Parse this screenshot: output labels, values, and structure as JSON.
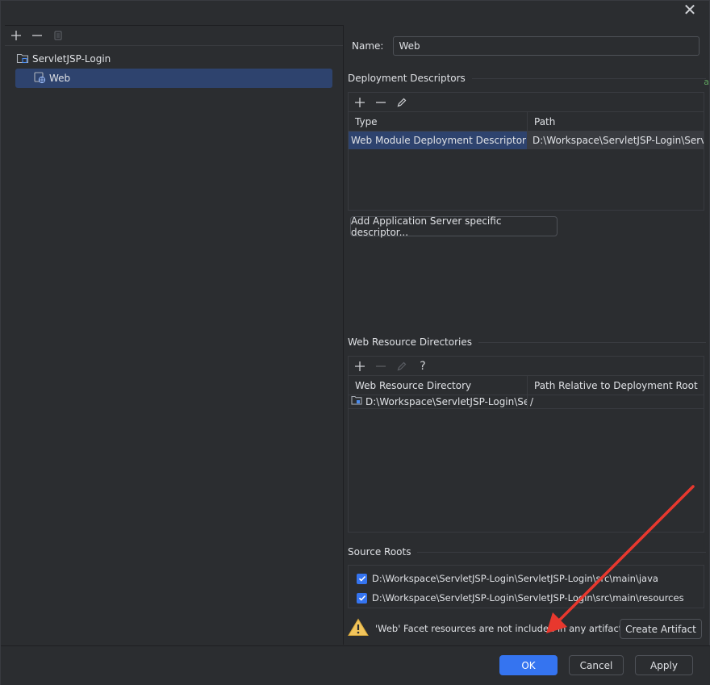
{
  "dialog": {
    "close_label": "✕"
  },
  "left": {
    "toolbar": {
      "add": "+",
      "remove": "−",
      "copy": "⧉"
    },
    "tree": [
      {
        "label": "ServletJSP-Login",
        "icon": "module-folder-icon"
      },
      {
        "label": "Web",
        "icon": "web-facet-icon"
      }
    ]
  },
  "right": {
    "name_label": "Name:",
    "name_value": "Web",
    "deployment": {
      "title": "Deployment Descriptors",
      "columns": [
        "Type",
        "Path"
      ],
      "rows": [
        {
          "type": "Web Module Deployment Descriptor",
          "path": "D:\\Workspace\\ServletJSP-Login\\ServletJ"
        }
      ],
      "add_server_button": "Add Application Server specific descriptor..."
    },
    "resources": {
      "title": "Web Resource Directories",
      "help": "?",
      "columns": [
        "Web Resource Directory",
        "Path Relative to Deployment Root"
      ],
      "rows": [
        {
          "dir": "D:\\Workspace\\ServletJSP-Login\\Se...",
          "rel": "/"
        }
      ]
    },
    "source_roots": {
      "title": "Source Roots",
      "items": [
        {
          "path": "D:\\Workspace\\ServletJSP-Login\\ServletJSP-Login\\src\\main\\java",
          "checked": true
        },
        {
          "path": "D:\\Workspace\\ServletJSP-Login\\ServletJSP-Login\\src\\main\\resources",
          "checked": true
        }
      ]
    },
    "warning": "'Web' Facet resources are not included in any artifacts",
    "create_artifact_button": "Create Artifact",
    "edge_fragment": "a"
  },
  "footer": {
    "ok": "OK",
    "cancel": "Cancel",
    "apply": "Apply"
  },
  "colors": {
    "accent": "#3574f0",
    "selection": "#2e436e",
    "warning": "#f2c55c",
    "annotation_arrow": "#e8382e"
  }
}
